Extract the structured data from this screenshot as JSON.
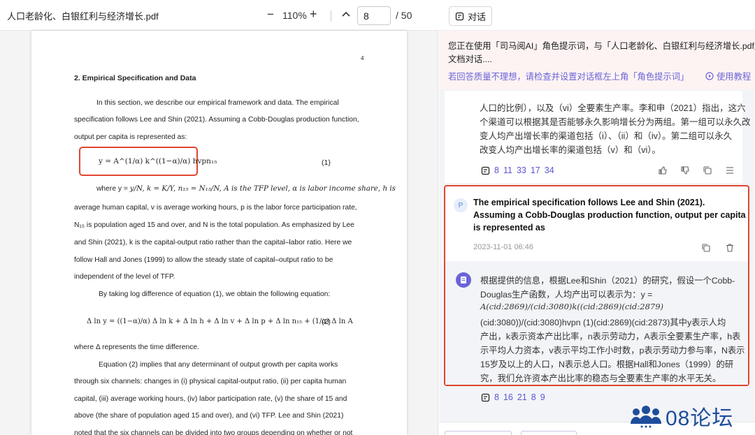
{
  "pdf": {
    "filename": "人口老龄化、白银红利与经济增长.pdf",
    "zoom": "110%",
    "zoom_out": "−",
    "zoom_in": "+",
    "page_current": "8",
    "page_total": "/ 50",
    "page": {
      "page_number": "4",
      "section_heading": "2.  Empirical Specification and Data",
      "lines": {
        "l1": "In this section, we describe our empirical framework and data. The empirical",
        "l2": "specification follows Lee and Shin (2021). Assuming a Cobb-Douglas production function,",
        "l3": "output per capita is represented as:",
        "l5a": "where y = ",
        "l5b": "y/N, k = K/Y, n₁₅ = N₁₅/N, A is the TFP level, α is labor income share, h is",
        "l6": "average human capital, v is average working hours, p is the labor force participation rate,",
        "l7": "N₁₅ is population aged 15 and over, and N is the total population. As emphasized by Lee",
        "l8": "and Shin (2021), k is the capital-output ratio rather than the capital–labor ratio. Here we",
        "l9": "follow Hall and Jones (1999) to allow the steady state of capital–output ratio to be",
        "l10": "independent of the level of TFP.",
        "l11": "By taking log difference of equation (1), we obtain the following equation:",
        "l13": "where Δ represents the time difference.",
        "l14": "Equation (2) implies that any determinant of output growth per capita works",
        "l15": "through six channels: changes in (i) physical capital-output ratio, (ii) per capita human",
        "l16": "capital, (iii) average working hours, (iv) labor participation rate, (v) the share of 15 and",
        "l17": "above (the share of population aged 15 and over), and (vi) TFP. Lee and Shin (2021)",
        "l18": "noted that the six channels can be divided into two groups depending on whether or not"
      },
      "eq1": "y = A^(1/α) k^((1−α)/α) hvpn₁₅",
      "eq1_label": "(1)",
      "eq2": "Δ ln y = ((1−α)/α) Δ ln k + Δ ln h + Δ ln v + Δ ln p + Δ ln n₁₅ + (1/α) Δ ln A",
      "eq2_label": "(2)"
    }
  },
  "chat": {
    "tab_label": "对话",
    "notice_line1": "您正在使用「司马阅AI」角色提示词，与「人口老龄化、白银红利与经济增长.pdf」",
    "notice_line2": "文档对话....",
    "notice_link": "若回答质量不理想，请检查并设置对话框左上角「角色提示词」",
    "tutorial_label": "使用教程",
    "prev_answer": {
      "lines": [
        "人口的比例），以及（vi）全要素生产率。李和申（2021）指出，这六",
        "个渠道可以根据其是否能够永久影响增长分为两组。第一组可以永久改",
        "变人均产出增长率的渠道包括（i）、（ii）和（iv）。第二组可以永久",
        "改变人均产出增长率的渠道包括（v）和（vi）。"
      ],
      "refs": [
        "8",
        "11",
        "33",
        "17",
        "34"
      ]
    },
    "question": {
      "avatar": "P",
      "lines": [
        "The empirical specification follows Lee and Shin (2021).",
        "Assuming a Cobb-Douglas production function, output per capita",
        "is represented as"
      ],
      "time": "2023-11-01 06:46"
    },
    "answer": {
      "lines": [
        "根据提供的信息，根据Lee和Shin（2021）的研究，假设一个Cobb-",
        "Douglas生产函数，人均产出可以表示为：y =",
        "A(cid:2869)/(cid:3080)k((cid:2869)(cid:2879)",
        "(cid:3080))/(cid:3080)hvpn (1)(cid:2869)(cid:2873)其中y表示人均",
        "产出，k表示资本产出比率，n表示劳动力，A表示全要素生产率，h表",
        "示平均人力资本，v表示平均工作小时数，p表示劳动力参与率，N表示",
        "15岁及以上的人口，N表示总人口。根据Hall和Jones（1999）的研",
        "究，我们允许资本产出比率的稳态与全要素生产率的水平无关。"
      ],
      "refs": [
        "8",
        "16",
        "21",
        "8",
        "9"
      ]
    }
  },
  "watermark": {
    "text": "08论坛"
  },
  "colors": {
    "accent": "#6c63d9",
    "highlight_box": "#e0462f",
    "watermark": "#1e4d9c"
  }
}
